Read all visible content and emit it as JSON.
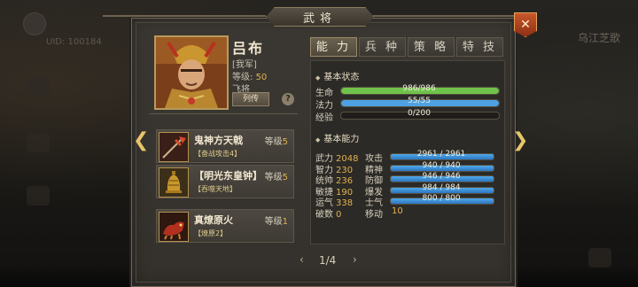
{
  "window": {
    "title": "武将",
    "close_label": "✕"
  },
  "background": {
    "uid_text": "UID: 100184",
    "right_text": "乌江芝歌"
  },
  "hero": {
    "name": "吕布",
    "faction": "[我军]",
    "level_label": "等级:",
    "level_value": "50",
    "rank": "飞将",
    "bio_button": "列传",
    "help_button": "?"
  },
  "equipment": [
    {
      "name": "鬼神方天戟",
      "level_label": "等级",
      "level": "5",
      "skill": "【奋战攻击4】",
      "icon": "halberd-icon"
    },
    {
      "name": "【明光东皇钟】",
      "level_label": "等级",
      "level": "5",
      "skill": "【吞噬天地】",
      "icon": "bell-icon"
    },
    {
      "name": "真燎原火",
      "level_label": "等级",
      "level": "1",
      "skill": "【燎原2】",
      "icon": "fire-beast-icon"
    }
  ],
  "tabs": [
    "能 力",
    "兵 种",
    "策 略",
    "特 技"
  ],
  "basic_status": {
    "header": "基本状态",
    "hp": {
      "label": "生命",
      "text": "986/986",
      "fill": 1.0
    },
    "mp": {
      "label": "法力",
      "text": "55/55",
      "fill": 1.0
    },
    "exp": {
      "label": "经验",
      "text": "0/200",
      "fill": 0.0
    }
  },
  "basic_ability": {
    "header": "基本能力",
    "left": [
      {
        "label": "武力",
        "value": "2048"
      },
      {
        "label": "智力",
        "value": "230"
      },
      {
        "label": "统帅",
        "value": "236"
      },
      {
        "label": "敏捷",
        "value": "190"
      },
      {
        "label": "运气",
        "value": "338"
      },
      {
        "label": "破数",
        "value": "0"
      }
    ],
    "right": [
      {
        "label": "攻击",
        "text": "2961 / 2961",
        "fill": 1.0
      },
      {
        "label": "精神",
        "text": "940 / 940",
        "fill": 1.0
      },
      {
        "label": "防御",
        "text": "946 / 946",
        "fill": 1.0
      },
      {
        "label": "爆发",
        "text": "984 / 984",
        "fill": 1.0
      },
      {
        "label": "士气",
        "text": "800 / 800",
        "fill": 1.0
      },
      {
        "label": "移动",
        "value": "10"
      }
    ]
  },
  "pager": {
    "prev": "‹",
    "current": "1/4",
    "next": "›"
  },
  "colors": {
    "hp": "#6fc24a",
    "mp": "#4ea2e3",
    "accent": "#e2b24f",
    "close": "#b84a22"
  }
}
